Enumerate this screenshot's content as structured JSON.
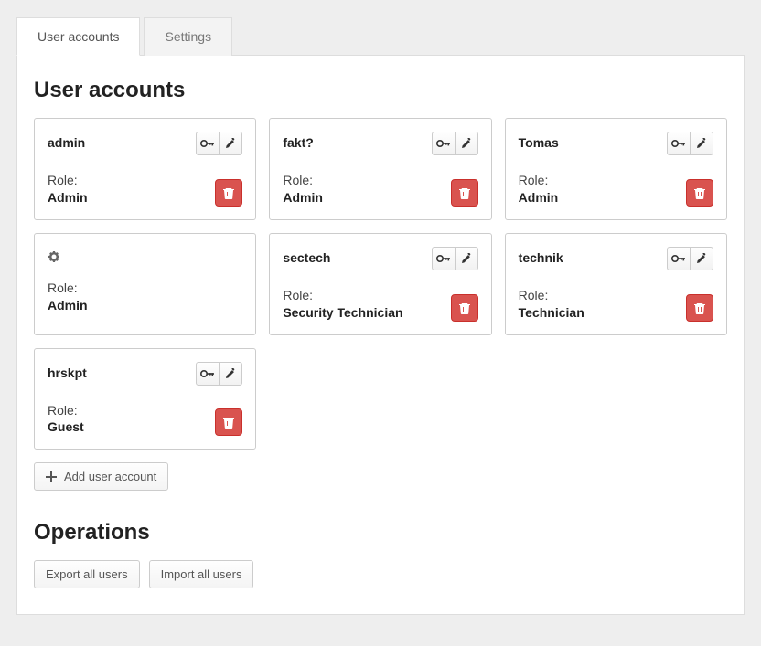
{
  "tabs": {
    "user_accounts": "User accounts",
    "settings": "Settings"
  },
  "section_titles": {
    "user_accounts": "User accounts",
    "operations": "Operations"
  },
  "role_label": "Role:",
  "users": [
    {
      "username": "admin",
      "role": "Admin",
      "show_actions": true,
      "is_gear": false
    },
    {
      "username": "fakt?",
      "role": "Admin",
      "show_actions": true,
      "is_gear": false
    },
    {
      "username": "Tomas",
      "role": "Admin",
      "show_actions": true,
      "is_gear": false
    },
    {
      "username": "",
      "role": "Admin",
      "show_actions": false,
      "is_gear": true
    },
    {
      "username": "sectech",
      "role": "Security Technician",
      "show_actions": true,
      "is_gear": false
    },
    {
      "username": "technik",
      "role": "Technician",
      "show_actions": true,
      "is_gear": false
    },
    {
      "username": "hrskpt",
      "role": "Guest",
      "show_actions": true,
      "is_gear": false
    }
  ],
  "buttons": {
    "add_user": "Add user account",
    "export_all": "Export all users",
    "import_all": "Import all users"
  }
}
